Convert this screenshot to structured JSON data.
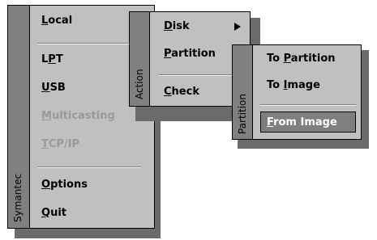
{
  "menus": {
    "main": {
      "band_label": "Symantec",
      "items": [
        {
          "label": "Local",
          "hot": "L",
          "rest": "ocal",
          "disabled": false
        },
        {
          "label": "LPT",
          "hot": "P",
          "pre": "L",
          "rest": "T",
          "disabled": false
        },
        {
          "label": "USB",
          "hot": "U",
          "rest": "SB",
          "disabled": false
        },
        {
          "label": "Multicasting",
          "hot": "M",
          "rest": "ulticasting",
          "disabled": true
        },
        {
          "label": "TCP/IP",
          "hot": "T",
          "rest": "CP/IP",
          "disabled": true
        },
        {
          "label": "Options",
          "hot": "O",
          "rest": "ptions",
          "disabled": false
        },
        {
          "label": "Quit",
          "hot": "Q",
          "rest": "uit",
          "disabled": false
        }
      ]
    },
    "action": {
      "band_label": "Action",
      "items": [
        {
          "label": "Disk",
          "hot": "D",
          "rest": "isk",
          "submenu": true
        },
        {
          "label": "Partition",
          "hot": "P",
          "rest": "artition",
          "submenu": false
        },
        {
          "label": "Check",
          "hot": "C",
          "rest": "heck",
          "submenu": false
        }
      ]
    },
    "partition": {
      "band_label": "Partition",
      "items": [
        {
          "label": "To Partition",
          "pre": "To ",
          "hot": "P",
          "rest": "artition",
          "selected": false
        },
        {
          "label": "To Image",
          "pre": "To ",
          "hot": "I",
          "rest": "mage",
          "selected": false
        },
        {
          "label": "From Image",
          "hot": "F",
          "rest": "rom Image",
          "selected": true
        }
      ]
    }
  },
  "colors": {
    "menu_bg": "#c0c0c0",
    "band_bg": "#808080",
    "shadow": "#6b6b6b",
    "disabled": "#9a9a9a",
    "selected_bg": "#7f7f7f"
  }
}
